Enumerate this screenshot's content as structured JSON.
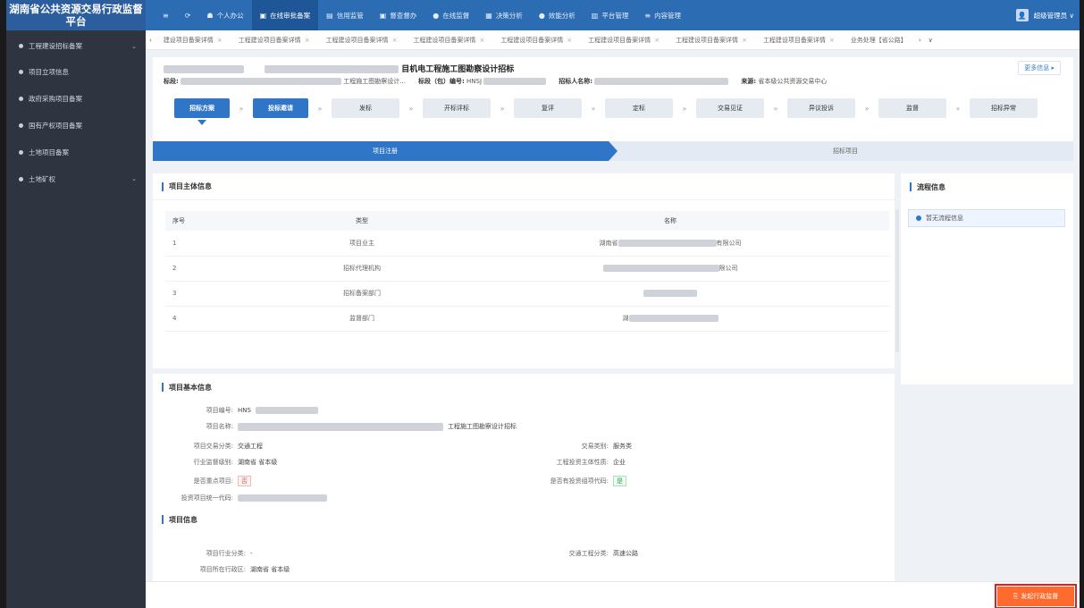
{
  "app": {
    "title": "湖南省公共资源交易行政监督平台"
  },
  "topnav": [
    {
      "icon": "≡",
      "label": ""
    },
    {
      "icon": "⟳",
      "label": ""
    },
    {
      "icon": "☗",
      "label": "个人办公"
    },
    {
      "icon": "▣",
      "label": "在线审批备案"
    },
    {
      "icon": "▤",
      "label": "信用监管"
    },
    {
      "icon": "▣",
      "label": "督查督办"
    },
    {
      "icon": "●",
      "label": "在线监督"
    },
    {
      "icon": "▦",
      "label": "决策分析"
    },
    {
      "icon": "●",
      "label": "效能分析"
    },
    {
      "icon": "▥",
      "label": "平台管理"
    },
    {
      "icon": "≡",
      "label": "内容管理"
    }
  ],
  "user": {
    "name": "超级管理员 ∨",
    "avatar_glyph": "👤"
  },
  "sidebar": [
    {
      "label": "工程建设招标备案",
      "expandable": true
    },
    {
      "label": "项目立项信息",
      "expandable": false
    },
    {
      "label": "政府采购项目备案",
      "expandable": false
    },
    {
      "label": "国有产权项目备案",
      "expandable": false
    },
    {
      "label": "土地项目备案",
      "expandable": false
    },
    {
      "label": "土地矿权",
      "expandable": true
    }
  ],
  "tabs": {
    "prev": "‹",
    "items": [
      "建设项目备案详情",
      "工程建设项目备案详情",
      "工程建设项目备案详情",
      "工程建设项目备案详情",
      "工程建设项目备案详情",
      "工程建设项目备案详情",
      "工程建设项目备案详情",
      "工程建设项目备案详情"
    ],
    "last": "业务处理【省公路】",
    "next": "›",
    "more": "∨"
  },
  "header": {
    "title_suffix": "目机电工程施工图勘察设计招标",
    "more_info": "更多信息 ▸",
    "section_label": "标段:",
    "section_value": "工程施工图勘察设计...",
    "package_label": "标段（包）编号:",
    "package_value": "HNSJ",
    "bidder_label": "招标人名称:",
    "source_label": "来源:",
    "source_value": "省本级公共资源交易中心"
  },
  "steps": [
    {
      "label": "招标方案",
      "done": true
    },
    {
      "label": "投标邀请",
      "done": true
    },
    {
      "label": "发标",
      "done": false
    },
    {
      "label": "开标评标",
      "done": false
    },
    {
      "label": "复评",
      "done": false
    },
    {
      "label": "定标",
      "done": false
    },
    {
      "label": "交易见证",
      "done": false
    },
    {
      "label": "异议投诉",
      "done": false
    },
    {
      "label": "监督",
      "done": false
    },
    {
      "label": "招标异常",
      "done": false
    }
  ],
  "progress": {
    "seg1": "项目注册",
    "seg2": "招标项目"
  },
  "subject": {
    "title": "项目主体信息",
    "headers": {
      "no": "序号",
      "type": "类型",
      "name": "名称"
    },
    "rows": [
      {
        "no": "1",
        "type": "项目业主",
        "name_prefix": "湖南省",
        "name_suffix": "有限公司"
      },
      {
        "no": "2",
        "type": "招标代理机构",
        "name_prefix": "",
        "name_suffix": "限公司"
      },
      {
        "no": "3",
        "type": "招标备案部门",
        "name_prefix": "",
        "name_suffix": ""
      },
      {
        "no": "4",
        "type": "监督部门",
        "name_prefix": "湖",
        "name_suffix": ""
      }
    ]
  },
  "flow": {
    "title": "流程信息",
    "empty_text": "暂无流程信息"
  },
  "basic": {
    "title": "项目基本信息",
    "project_no_label": "项目编号:",
    "project_no_value": "HNS",
    "project_name_label": "项目名称:",
    "project_name_value": "工程施工图勘察设计招标",
    "trade_cat_label": "项目交易分类:",
    "trade_cat_value": "交通工程",
    "trade_type_label": "交易类别:",
    "trade_type_value": "服务类",
    "supervise_level_label": "行业监督级别:",
    "supervise_level_value": "湖南省 省本级",
    "invest_nature_label": "工程投资主体性质:",
    "invest_nature_value": "企业",
    "key_project_label": "是否重点项目:",
    "key_project_value": "否",
    "has_code_label": "是否有投资组项代码:",
    "has_code_value": "是",
    "unified_code_label": "投资项目统一代码:"
  },
  "projinfo": {
    "title": "项目信息",
    "industry_label": "项目行业分类:",
    "industry_value": "-",
    "traffic_label": "交通工程分类:",
    "traffic_value": "高速公路",
    "region_label": "项目所在行政区:",
    "region_value": "湖南省 省本级"
  },
  "action": {
    "icon": "⎘",
    "label": "发起行政监督"
  }
}
